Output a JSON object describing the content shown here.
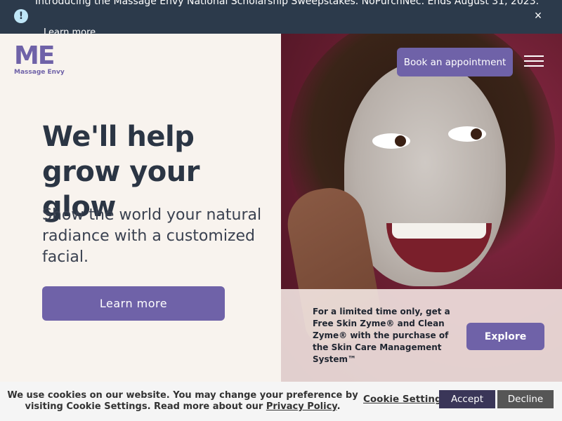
{
  "announcement": {
    "text": "Introducing the Massage Envy National Scholarship Sweepstakes. NoPurchNec. Ends August 31, 2023.",
    "link_label": "Learn more",
    "alert_icon": "!",
    "close_icon": "×"
  },
  "logo": {
    "mark": "ME",
    "wordmark": "Massage Envy"
  },
  "header": {
    "book_label": "Book an appointment"
  },
  "hero": {
    "headline": "We'll help grow your glow",
    "subhead": "Show the world your natural radiance with a customized facial.",
    "cta_label": "Learn more"
  },
  "promo": {
    "text": "For a limited time only, get a Free Skin Zyme® and Clean Zyme® with the purchase of the Skin Care Management System™",
    "cta_label": "Explore"
  },
  "cookie": {
    "text_part1": "We use cookies on our website. You may change your preference by visiting Cookie Settings. Read more about our ",
    "privacy_link": "Privacy Policy",
    "text_part2": ".",
    "settings_label": "Cookie Settings",
    "accept_label": "Accept",
    "decline_label": "Decline"
  },
  "colors": {
    "brand_purple": "#6f62a8",
    "navy": "#2c3a4b",
    "cream": "#f8f3ee"
  }
}
